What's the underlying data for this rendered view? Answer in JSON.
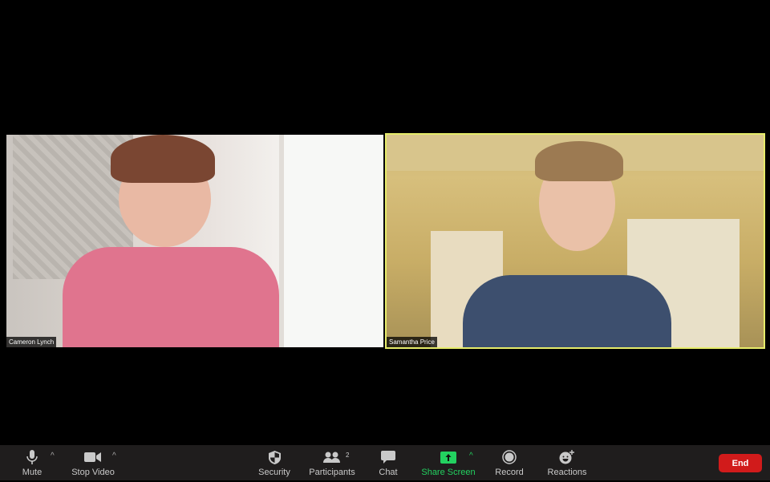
{
  "participants": [
    {
      "name": "Cameron Lynch",
      "active_speaker": false
    },
    {
      "name": "Samantha Price",
      "active_speaker": true
    }
  ],
  "toolbar": {
    "mute": "Mute",
    "stop_video": "Stop Video",
    "security": "Security",
    "participants": "Participants",
    "participants_count": "2",
    "chat": "Chat",
    "share_screen": "Share Screen",
    "record": "Record",
    "reactions": "Reactions",
    "end": "End"
  },
  "colors": {
    "active_speaker_border": "#e6ec6a",
    "share_screen": "#23d160",
    "end_button": "#d11b1b",
    "toolbar_bg": "#1f1d1d"
  }
}
